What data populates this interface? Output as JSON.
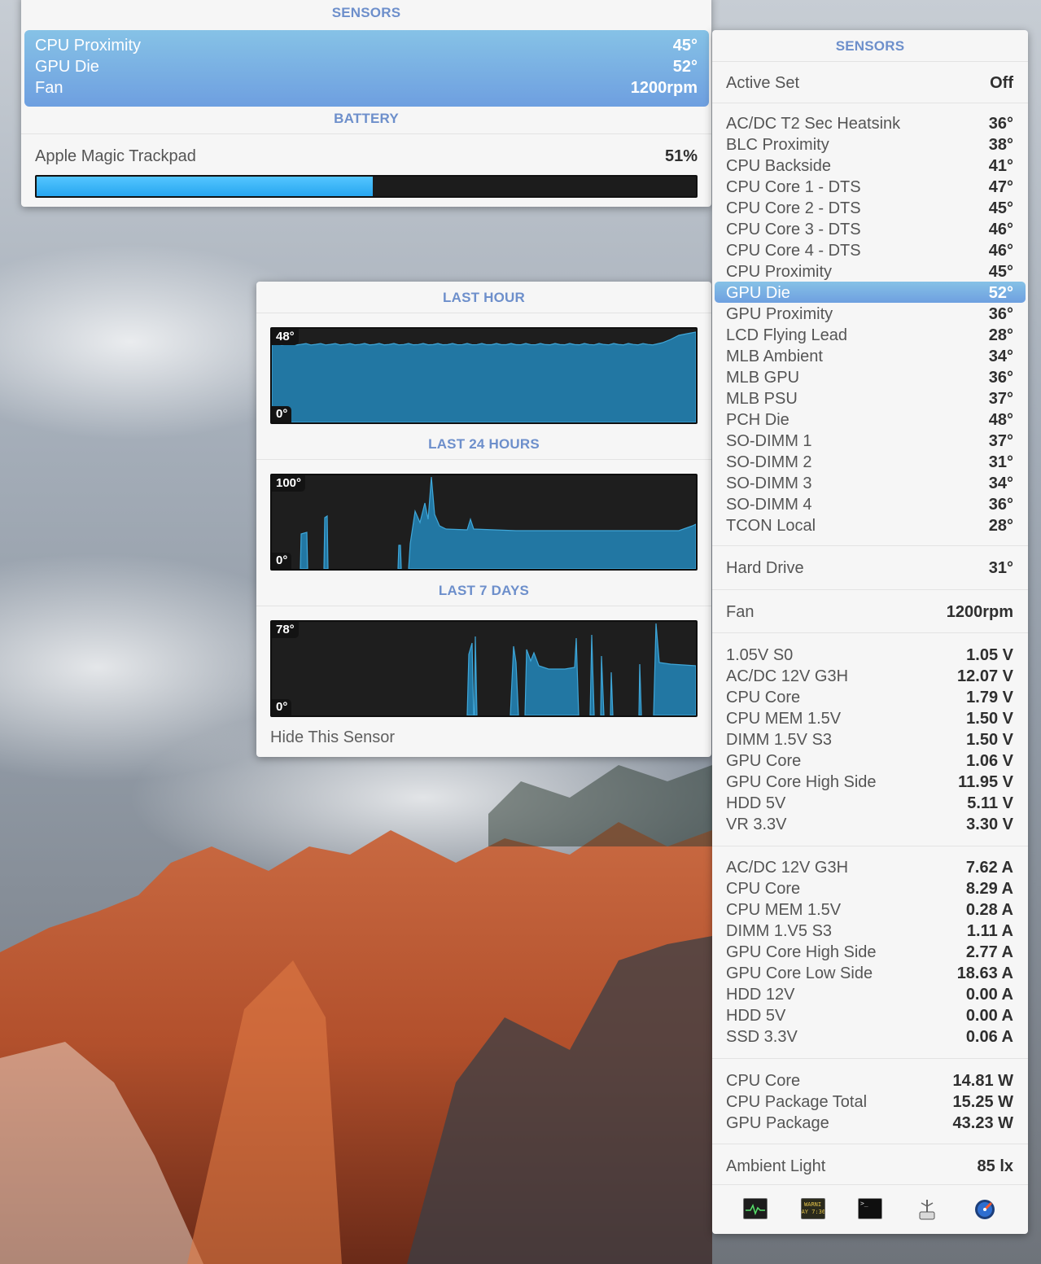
{
  "top_panel": {
    "sensors_title": "SENSORS",
    "selected": [
      {
        "label": "CPU Proximity",
        "value": "45°"
      },
      {
        "label": "GPU Die",
        "value": "52°"
      },
      {
        "label": "Fan",
        "value": "1200rpm"
      }
    ],
    "battery_title": "BATTERY",
    "battery": {
      "device": "Apple Magic Trackpad",
      "percent_label": "51%",
      "level": 0.51,
      "fill_color": "#34b4fa"
    }
  },
  "graph_panel": {
    "last_hour": {
      "title": "LAST HOUR",
      "max_label": "48°",
      "min_label": "0°"
    },
    "last_24": {
      "title": "LAST 24 HOURS",
      "max_label": "100°",
      "min_label": "0°"
    },
    "last_7": {
      "title": "LAST 7 DAYS",
      "max_label": "78°",
      "min_label": "0°"
    },
    "hide_label": "Hide This Sensor",
    "fill_color": "#2277a3",
    "line_color": "#3fa7d9"
  },
  "sensors_panel": {
    "title": "SENSORS",
    "active_set": {
      "label": "Active Set",
      "value": "Off"
    },
    "temperatures": [
      {
        "label": "AC/DC T2 Sec Heatsink",
        "value": "36°"
      },
      {
        "label": "BLC Proximity",
        "value": "38°"
      },
      {
        "label": "CPU Backside",
        "value": "41°"
      },
      {
        "label": "CPU Core 1 - DTS",
        "value": "47°"
      },
      {
        "label": "CPU Core 2 - DTS",
        "value": "45°"
      },
      {
        "label": "CPU Core 3 - DTS",
        "value": "46°"
      },
      {
        "label": "CPU Core 4 - DTS",
        "value": "46°"
      },
      {
        "label": "CPU Proximity",
        "value": "45°"
      },
      {
        "label": "GPU Die",
        "value": "52°"
      },
      {
        "label": "GPU Proximity",
        "value": "36°"
      },
      {
        "label": "LCD Flying Lead",
        "value": "28°"
      },
      {
        "label": "MLB Ambient",
        "value": "34°"
      },
      {
        "label": "MLB GPU",
        "value": "36°"
      },
      {
        "label": "MLB PSU",
        "value": "37°"
      },
      {
        "label": "PCH Die",
        "value": "48°"
      },
      {
        "label": "SO-DIMM 1",
        "value": "37°"
      },
      {
        "label": "SO-DIMM 2",
        "value": "31°"
      },
      {
        "label": "SO-DIMM 3",
        "value": "34°"
      },
      {
        "label": "SO-DIMM 4",
        "value": "36°"
      },
      {
        "label": "TCON Local",
        "value": "28°"
      }
    ],
    "highlighted_index": 8,
    "hard_drive": {
      "label": "Hard Drive",
      "value": "31°"
    },
    "fan": {
      "label": "Fan",
      "value": "1200rpm"
    },
    "voltages": [
      {
        "label": "1.05V S0",
        "value": "1.05 V"
      },
      {
        "label": "AC/DC 12V G3H",
        "value": "12.07 V"
      },
      {
        "label": "CPU Core",
        "value": "1.79 V"
      },
      {
        "label": "CPU MEM 1.5V",
        "value": "1.50 V"
      },
      {
        "label": "DIMM 1.5V S3",
        "value": "1.50 V"
      },
      {
        "label": "GPU Core",
        "value": "1.06 V"
      },
      {
        "label": "GPU Core High Side",
        "value": "11.95 V"
      },
      {
        "label": "HDD 5V",
        "value": "5.11 V"
      },
      {
        "label": "VR 3.3V",
        "value": "3.30 V"
      }
    ],
    "currents": [
      {
        "label": "AC/DC 12V G3H",
        "value": "7.62 A"
      },
      {
        "label": "CPU Core",
        "value": "8.29 A"
      },
      {
        "label": "CPU MEM 1.5V",
        "value": "0.28 A"
      },
      {
        "label": "DIMM 1.V5 S3",
        "value": "1.11 A"
      },
      {
        "label": "GPU Core High Side",
        "value": "2.77 A"
      },
      {
        "label": "GPU Core Low Side",
        "value": "18.63 A"
      },
      {
        "label": "HDD 12V",
        "value": "0.00 A"
      },
      {
        "label": "HDD 5V",
        "value": "0.00 A"
      },
      {
        "label": "SSD 3.3V",
        "value": "0.06 A"
      }
    ],
    "power": [
      {
        "label": "CPU Core",
        "value": "14.81 W"
      },
      {
        "label": "CPU Package Total",
        "value": "15.25 W"
      },
      {
        "label": "GPU Package",
        "value": "43.23 W"
      }
    ],
    "ambient": {
      "label": "Ambient Light",
      "value": "85 lx"
    }
  },
  "toolbar": [
    {
      "name": "activity-monitor-icon"
    },
    {
      "name": "console-icon",
      "text": "WARNI\nAY 7:36"
    },
    {
      "name": "terminal-icon",
      "text": ">_"
    },
    {
      "name": "usb-icon"
    },
    {
      "name": "istat-icon"
    }
  ]
}
